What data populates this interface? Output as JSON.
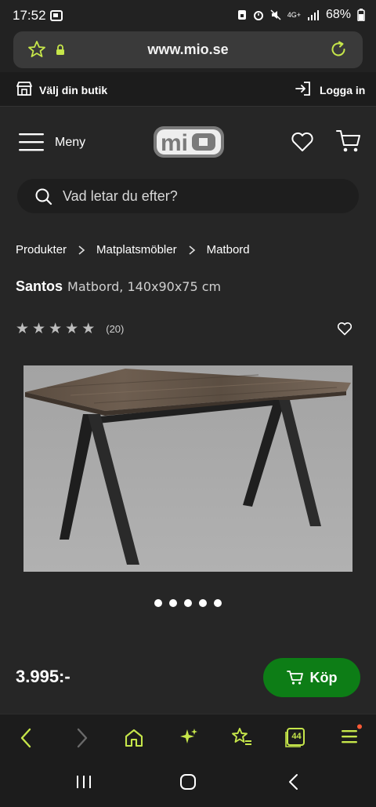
{
  "status_bar": {
    "time": "17:52",
    "battery": "68%",
    "network": "4G+"
  },
  "browser": {
    "url": "www.mio.se",
    "tab_count": "44"
  },
  "store_bar": {
    "choose_store": "Välj din butik",
    "login": "Logga in"
  },
  "header": {
    "menu_label": "Meny",
    "logo": "MiO",
    "search_placeholder": "Vad letar du efter?"
  },
  "breadcrumb": [
    "Produkter",
    "Matplatsmöbler",
    "Matbord"
  ],
  "product": {
    "name": "Santos",
    "description": "Matbord, 140x90x75 cm",
    "rating_stars": 5,
    "review_count": "(20)",
    "image_count": 5,
    "price": "3.995:-",
    "buy_label": "Köp"
  },
  "colors": {
    "accent": "#c6e64a",
    "buy": "#0d7d16",
    "background": "#262626",
    "notification": "#ff5a36"
  }
}
